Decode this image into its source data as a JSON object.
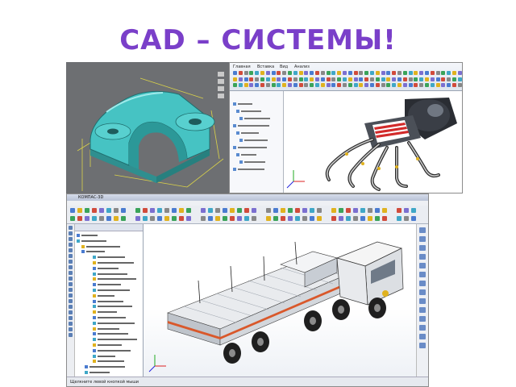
{
  "slide": {
    "title": "CAD – СИСТЕМЫ!",
    "title_color": "#7a3fc9"
  },
  "screenshots": [
    {
      "id": "screenshot-bracket",
      "subject": "green 3D bracket part with dimension lines",
      "background": "#6d6f72",
      "part_color": "#3fb8b8",
      "dimension_color": "#d9d24a"
    },
    {
      "id": "screenshot-robot-hand",
      "subject": "robotic claw assembly in ribbon-style CAD window",
      "ribbon_tabs": [
        "Главная",
        "Вставка",
        "Вид",
        "Анализ"
      ],
      "tree_rows": 10
    },
    {
      "id": "screenshot-truck",
      "subject": "multi-axle military truck assembly with model tree",
      "window_title": "КОМПАС-3D",
      "status_text": "Щелкните левой кнопкой мыши",
      "tree_rows": 26,
      "accent_stripe": "#d9582b"
    }
  ],
  "icons": [
    "axis-triad-icon",
    "toolbar-icon",
    "tree-node-icon",
    "panel-tool-icon"
  ]
}
